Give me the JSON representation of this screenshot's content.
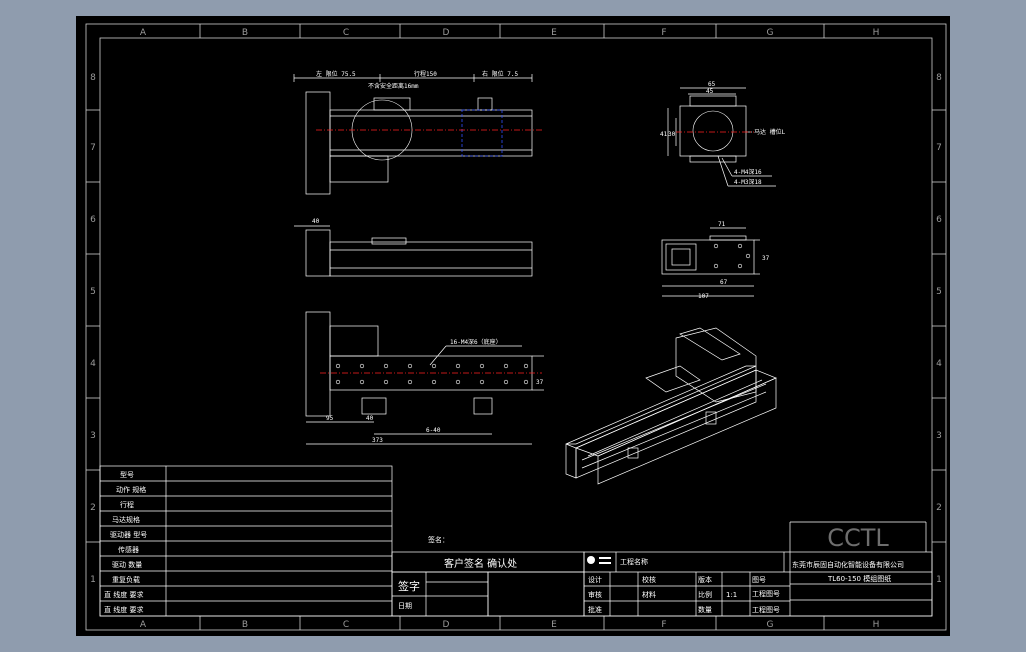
{
  "frame": {
    "col_labels": [
      "A",
      "B",
      "C",
      "D",
      "E",
      "F",
      "G",
      "H"
    ],
    "row_labels": [
      "8",
      "7",
      "6",
      "5",
      "4",
      "3",
      "2",
      "1"
    ]
  },
  "colors": {
    "background": "#000000",
    "outside": "#8f9cae",
    "line": "#ffffff",
    "centerline": "#ff2020",
    "hidden": "#3050ff",
    "grid_label": "#9a9a9a"
  },
  "top_view": {
    "dim_left": "左 限位 75.5",
    "dim_stroke": "行程150",
    "dim_right": "右 限位 7.5",
    "safety_note": "不含安全距离16mm"
  },
  "side_view": {
    "dim_top": "40"
  },
  "bottom_view": {
    "hole_note": "16-M4深6（底座）",
    "dim_95": "95",
    "dim_40": "40",
    "dim_6x40": "6-40",
    "dim_overall": "373",
    "dim_height": "37"
  },
  "end_view": {
    "dim_top1": "65",
    "dim_top2": "45",
    "dim_left1": "41",
    "dim_left2": "30",
    "note_motor": "马达 槽位L",
    "note_m4": "4-M4深16",
    "note_m3": "4-M3深18"
  },
  "section_view": {
    "dim_top": "71",
    "dim_inner": "67",
    "dim_overall": "107",
    "dim_right": "37"
  },
  "title_block_left": {
    "rows": [
      "型号",
      "动作 规格",
      "行程",
      "马达规格",
      "驱动器 型号",
      "传感器",
      "驱动 数量",
      "重复负载",
      "直 线度 要求",
      "直 线度 要求"
    ]
  },
  "signoff": {
    "sign_label": "签名：",
    "confirm_title": "客户签名 确认处",
    "sign_field": "签字",
    "date_field": "日期"
  },
  "title_block_right": {
    "logo": "CCTL",
    "company": "东莞市辰固自动化智能设备有限公司",
    "product_name": "TL60-150 模组图纸",
    "project_label": "工程名称",
    "design": "设计",
    "review": "审核",
    "check": "校核",
    "approve": "批准",
    "material": "材料",
    "scale_label": "比例",
    "scale_value": "1:1",
    "version_label": "版本",
    "quantity": "数量",
    "drawing_no": "图号",
    "sheet1": "工程图号",
    "sheet2": "工程图号"
  }
}
